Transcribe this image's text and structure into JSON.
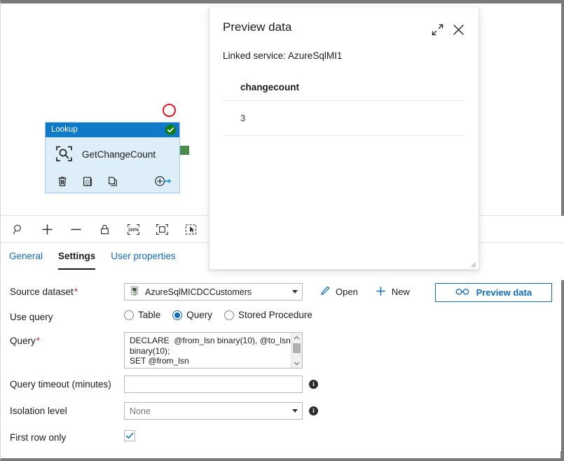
{
  "canvas": {
    "activity": {
      "type_label": "Lookup",
      "name": "GetChangeCount",
      "status": "succeeded-check",
      "icons": {
        "lookup": "lookup-magnifier-icon",
        "status": "success-check-icon",
        "delete": "trash-icon",
        "code": "code-braces-icon",
        "clone": "copy-icon",
        "add_output": "add-output-arrow-icon"
      },
      "annotation": "red-highlight-circle"
    },
    "toolbar": {
      "buttons": [
        {
          "name": "search-icon",
          "label": "Search"
        },
        {
          "name": "zoom-in-icon",
          "label": "Zoom in"
        },
        {
          "name": "zoom-out-icon",
          "label": "Zoom out"
        },
        {
          "name": "lock-icon",
          "label": "Lock canvas"
        },
        {
          "name": "zoom-100-icon",
          "label": "100%"
        },
        {
          "name": "fit-to-screen-icon",
          "label": "Fit to screen"
        },
        {
          "name": "auto-align-icon",
          "label": "Select / pointer"
        }
      ],
      "zoom_level_label": "100%"
    }
  },
  "tabs": [
    {
      "label": "General",
      "active": false
    },
    {
      "label": "Settings",
      "active": true
    },
    {
      "label": "User properties",
      "active": false
    }
  ],
  "settings": {
    "source_dataset": {
      "label": "Source dataset",
      "required_marker": "*",
      "value": "AzureSqlMICDCCustomers",
      "dataset_icon": "dataset-icon",
      "open_button": {
        "label": "Open",
        "icon": "pencil-icon"
      },
      "new_button": {
        "label": "New",
        "icon": "plus-icon"
      },
      "preview_button": {
        "label": "Preview data",
        "icon": "glasses-icon"
      }
    },
    "use_query": {
      "label": "Use query",
      "options": [
        {
          "label": "Table",
          "checked": false
        },
        {
          "label": "Query",
          "checked": true
        },
        {
          "label": "Stored Procedure",
          "checked": false
        }
      ]
    },
    "query": {
      "label": "Query",
      "required_marker": "*",
      "value": "DECLARE  @from_lsn binary(10), @to_lsn binary(10);\nSET @from_lsn"
    },
    "query_timeout": {
      "label": "Query timeout (minutes)",
      "value": "",
      "info_icon": "info-icon"
    },
    "isolation_level": {
      "label": "Isolation level",
      "value": "None",
      "info_icon": "info-icon"
    },
    "first_row_only": {
      "label": "First row only",
      "checked": true,
      "check_icon": "checkmark-icon"
    }
  },
  "preview_panel": {
    "title": "Preview data",
    "expand_icon": "expand-diagonal-icon",
    "close_icon": "close-x-icon",
    "linked_service_text": "Linked service: AzureSqlMI1",
    "table": {
      "columns": [
        "changecount"
      ],
      "rows": [
        [
          "3"
        ]
      ]
    },
    "resize_grip": "resize-grip-icon"
  },
  "colors": {
    "accent_blue": "#0f6cbd",
    "node_header_blue": "#0f7ac7",
    "node_body_blue": "#deeef8",
    "success_green": "#107c10",
    "connector_green": "#4a8a4a",
    "required_red": "#d13438",
    "annotation_red": "#e81123"
  }
}
